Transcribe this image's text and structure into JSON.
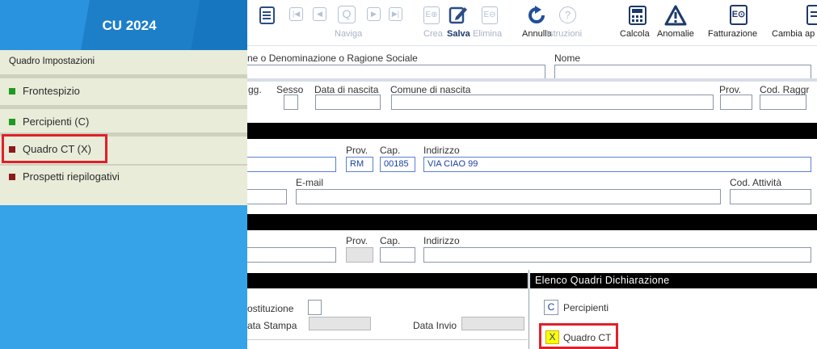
{
  "sidebar": {
    "title": "CU 2024",
    "section_label": "Quadro Impostazioni",
    "items": [
      {
        "label": "Frontespizio",
        "color": "#1e9b1e"
      },
      {
        "label": "Percipienti (C)",
        "color": "#1e9b1e"
      },
      {
        "label": "Quadro CT (X)",
        "color": "#8b1a1a",
        "highlighted": true
      },
      {
        "label": "Prospetti riepilogativi",
        "color": "#8b1a1a"
      }
    ]
  },
  "toolbar": {
    "naviga": "Naviga",
    "crea": "Crea",
    "salva": "Salva",
    "elimina": "Elimina",
    "annulla": "Annulla",
    "istruzioni": "Istruzioni",
    "calcola": "Calcola",
    "anomalie": "Anomalie",
    "fatturazione": "Fatturazione",
    "cambia": "Cambia ap",
    "icons": [
      "list-icon",
      "first-icon",
      "prev-icon",
      "search-icon",
      "next-icon",
      "last-icon",
      "new-icon",
      "save-icon",
      "delete-icon",
      "undo-icon",
      "help-icon",
      "calculator-icon",
      "warning-icon",
      "invoice-icon",
      "switch-app-icon"
    ]
  },
  "form": {
    "cognome_label": "ne o Denominazione o Ragione Sociale",
    "nome_label": "Nome",
    "cognome_value": "",
    "nome_value": "",
    "agg_label": "gg.",
    "sesso_label": "Sesso",
    "nascita_label": "Data di nascita",
    "comune_label": "Comune di nascita",
    "prov_label": "Prov.",
    "codraggr_label": "Cod. Raggr",
    "res_prov_label": "Prov.",
    "res_cap_label": "Cap.",
    "res_indirizzo_label": "Indirizzo",
    "res_prov_value": "RM",
    "res_cap_value": "00185",
    "res_indirizzo_value": "VIA CIAO 99",
    "email_label": "E-mail",
    "codattivita_label": "Cod. Attività",
    "dom_prov_label": "Prov.",
    "dom_cap_label": "Cap.",
    "dom_indirizzo_label": "Indirizzo",
    "costituzione_label": "ostituzione",
    "datastampa_label": "ata Stampa",
    "datainvio_label": "Data Invio"
  },
  "quadri": {
    "title": "Elenco Quadri Dichiarazione",
    "items": [
      {
        "code": "C",
        "label": "Percipienti"
      },
      {
        "code": "X",
        "label": "Quadro CT",
        "highlighted": true
      }
    ]
  },
  "colors": {
    "accent_blue": "#1b87d9",
    "sidebar_bg": "#36a3e8",
    "menu_bg": "#e8ecd9",
    "highlight_red": "#e0202a",
    "check_yellow": "#ffff00"
  }
}
